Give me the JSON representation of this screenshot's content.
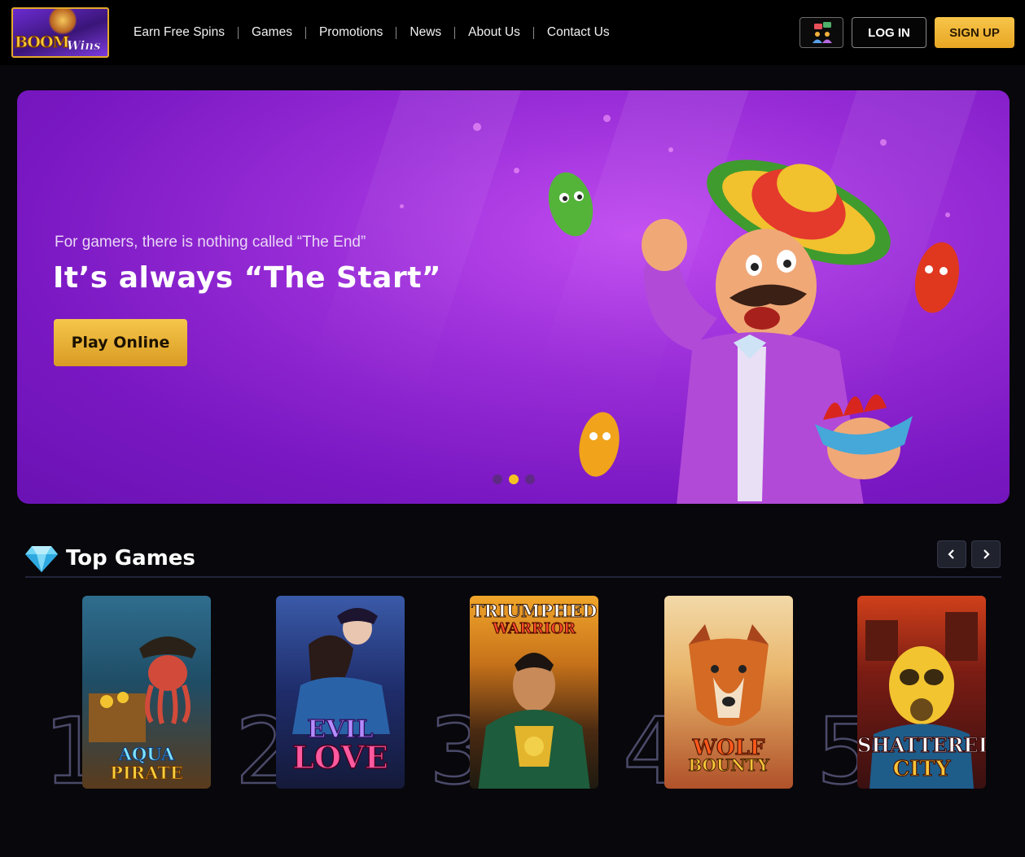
{
  "brand": {
    "logo_word_1": "BOOM",
    "logo_word_2": "Wins"
  },
  "nav": {
    "items": [
      "Earn Free Spins",
      "Games",
      "Promotions",
      "News",
      "About Us",
      "Contact Us"
    ]
  },
  "header": {
    "login_label": "LOG IN",
    "signup_label": "SIGN UP",
    "accent": "#f2b93b"
  },
  "hero": {
    "subtitle": "For gamers, there is nothing called “The End”",
    "title": "It’s always “The Start”",
    "cta_label": "Play Online",
    "slides": 3,
    "active_slide": 2,
    "background_color": "#9a2ed8"
  },
  "top_games": {
    "title": "Top Games",
    "icon": "diamond-icon",
    "games": [
      {
        "rank": "1",
        "name_line_1": "AQUA",
        "name_line_2": "PIRATE"
      },
      {
        "rank": "2",
        "name_line_1": "EVIL",
        "name_line_2": "LOVE"
      },
      {
        "rank": "3",
        "name_line_1": "TRIUMPHED",
        "name_line_2": "WARRIOR"
      },
      {
        "rank": "4",
        "name_line_1": "WOLF",
        "name_line_2": "BOUNTY"
      },
      {
        "rank": "5",
        "name_line_1": "SHATTERED",
        "name_line_2": "CITY"
      }
    ]
  }
}
